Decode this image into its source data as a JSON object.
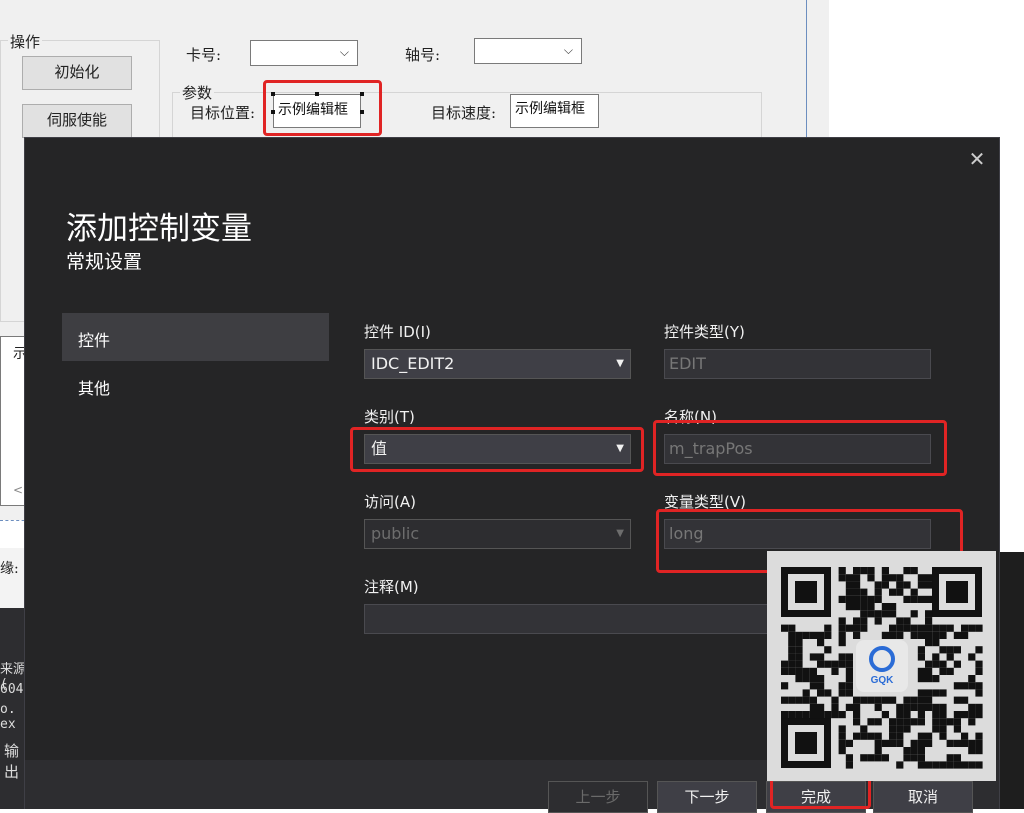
{
  "form": {
    "group_ops": "操作",
    "btn_init": "初始化",
    "btn_servo": "伺服使能",
    "card_label": "卡号:",
    "axis_label": "轴号:",
    "chevron": "⌵",
    "params_group": "参数",
    "target_pos_label": "目标位置:",
    "target_pos_edit": "示例编辑框",
    "target_speed_label": "目标速度:",
    "target_speed_edit": "示例编辑框",
    "list_fragment": "示",
    "scroll_left": "<"
  },
  "background_ide": {
    "frag1": "缘:",
    "frag2": "来源(",
    "frag3": "604",
    "frag4": "o. ex",
    "frag5": "输出"
  },
  "dialog": {
    "title": "添加控制变量",
    "subtitle": "常规设置",
    "close_icon": "✕",
    "nav": [
      {
        "label": "控件",
        "selected": true
      },
      {
        "label": "其他",
        "selected": false
      }
    ],
    "fields": {
      "control_id_label": "控件 ID(I)",
      "control_id_value": "IDC_EDIT2",
      "control_type_label": "控件类型(Y)",
      "control_type_value": "EDIT",
      "category_label": "类别(T)",
      "category_value": "值",
      "name_label": "名称(N)",
      "name_value": "m_trapPos",
      "access_label": "访问(A)",
      "access_value": "public",
      "var_type_label": "变量类型(V)",
      "var_type_value": "long",
      "comment_label": "注释(M)",
      "comment_value": ""
    },
    "buttons": {
      "prev": "上一步",
      "next": "下一步",
      "finish": "完成",
      "cancel": "取消"
    }
  },
  "qr": {
    "logo_text": "GQK"
  },
  "colors": {
    "dialog_bg": "#252526",
    "highlight_red": "#e02424",
    "dropdown_bg": "#3f3f46"
  }
}
